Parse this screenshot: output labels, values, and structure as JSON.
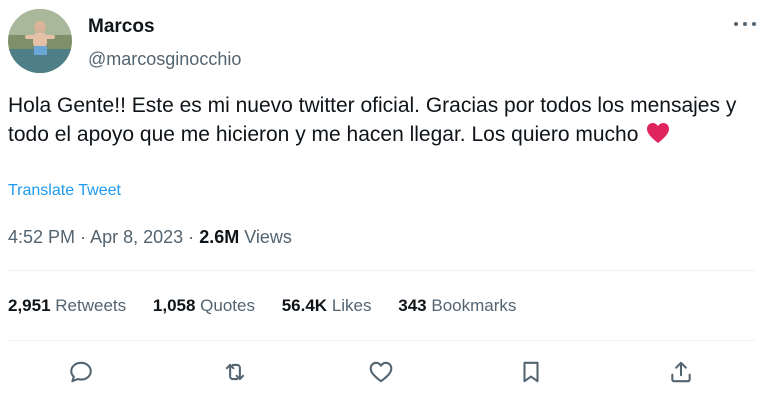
{
  "author": {
    "display_name": "Marcos",
    "handle": "@marcosginocchio",
    "avatar_icon": "profile-photo"
  },
  "tweet": {
    "text": "Hola Gente!! Este es mi nuevo twitter oficial. Gracias por todos los mensajes y todo el apoyo que me hicieron y me hacen llegar. Los quiero mucho",
    "emoji": "red-heart",
    "translate_label": "Translate Tweet"
  },
  "meta": {
    "time": "4:52 PM",
    "separator": "·",
    "date": "Apr 8, 2023",
    "views_count": "2.6M",
    "views_label": "Views"
  },
  "stats": [
    {
      "count": "2,951",
      "label": "Retweets"
    },
    {
      "count": "1,058",
      "label": "Quotes"
    },
    {
      "count": "56.4K",
      "label": "Likes"
    },
    {
      "count": "343",
      "label": "Bookmarks"
    }
  ],
  "actions": [
    "reply-icon",
    "retweet-icon",
    "like-icon",
    "bookmark-icon",
    "share-icon"
  ],
  "colors": {
    "text": "#0f1419",
    "secondary": "#536471",
    "link": "#1d9bf0",
    "divider": "#eff3f4",
    "heart": "#e0245e"
  }
}
